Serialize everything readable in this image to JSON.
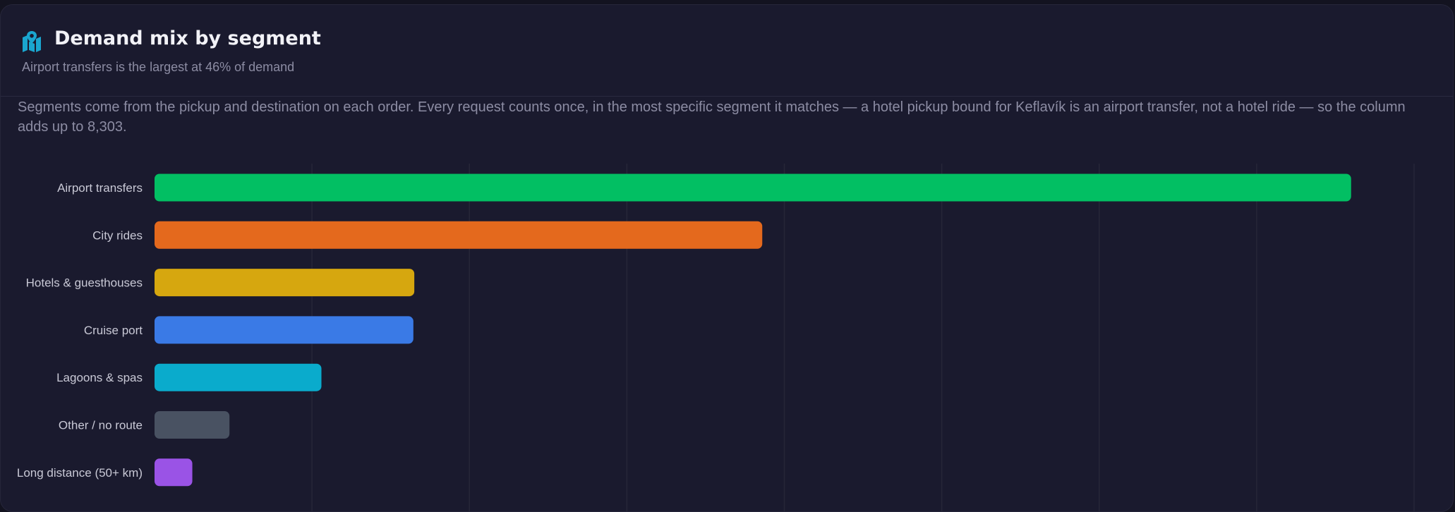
{
  "header": {
    "title": "Demand mix by segment",
    "subtitle": "Airport transfers is the largest at 46% of demand",
    "icon": "map-pin-icon"
  },
  "description": "Segments come from the pickup and destination on each order. Every request counts once, in the most specific segment it matches — a hotel pickup bound for Keflavík is an airport transfer, not a hotel ride — so the column adds up to 8,303.",
  "chart_data": {
    "type": "bar",
    "orientation": "horizontal",
    "categories": [
      "Airport transfers",
      "City rides",
      "Hotels & guesthouses",
      "Cruise port",
      "Lagoons & spas",
      "Other / no route",
      "Long distance (50+ km)"
    ],
    "values": [
      3800,
      1930,
      825,
      822,
      530,
      238,
      120
    ],
    "colors": [
      "#02bf63",
      "#e4691d",
      "#d6a70f",
      "#3a7ae6",
      "#0aabcc",
      "#495262",
      "#9a53e6"
    ],
    "xlim": [
      0,
      4000
    ],
    "grid": true,
    "legend": "none"
  },
  "theme": {
    "background": "#1a1a2e",
    "accent": "#1aa6cf"
  }
}
